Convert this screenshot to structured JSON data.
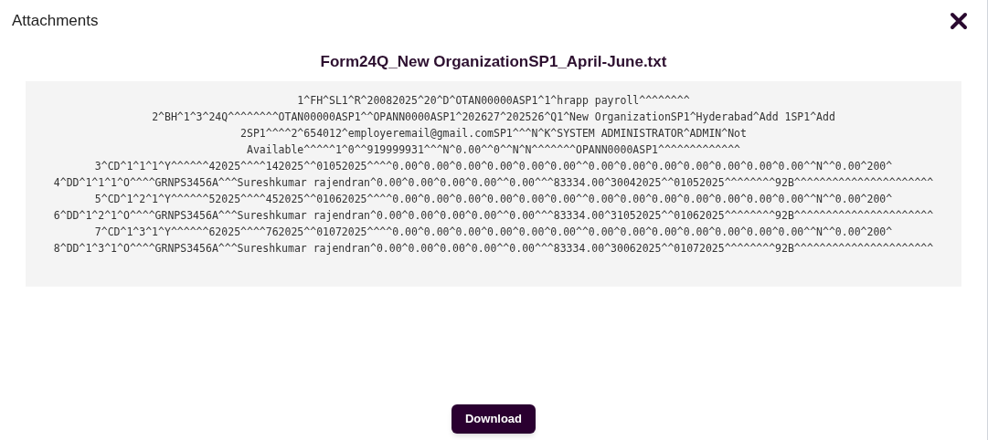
{
  "dialog": {
    "title": "Attachments"
  },
  "file": {
    "name": "Form24Q_New OrganizationSP1_April-June.txt",
    "lines": [
      "1^FH^SL1^R^20082025^20^D^OTAN00000ASP1^1^hrapp payroll^^^^^^^^",
      "2^BH^1^3^24Q^^^^^^^^OTAN00000ASP1^^OPANN0000ASP1^202627^202526^Q1^New OrganizationSP1^Hyderabad^Add 1SP1^Add",
      "2SP1^^^^2^654012^employeremail@gmail.comSP1^^^N^K^SYSTEM ADMINISTRATOR^ADMIN^Not",
      "Available^^^^^1^0^^919999931^^^N^0.00^^0^^N^N^^^^^^^OPANN0000ASP1^^^^^^^^^^^^^",
      "3^CD^1^1^1^Y^^^^^^42025^^^^142025^^01052025^^^^0.00^0.00^0.00^0.00^0.00^0.00^^0.00^0.00^0.00^0.00^0.00^0.00^0.00^^N^^0.00^200^",
      "4^DD^1^1^1^O^^^^GRNPS3456A^^^Sureshkumar rajendran^0.00^0.00^0.00^0.00^^0.00^^^83334.00^30042025^^01052025^^^^^^^^92B^^^^^^^^^^^^^^^^^^^^^^",
      "5^CD^1^2^1^Y^^^^^^52025^^^^452025^^01062025^^^^0.00^0.00^0.00^0.00^0.00^0.00^^0.00^0.00^0.00^0.00^0.00^0.00^0.00^^N^^0.00^200^",
      "6^DD^1^2^1^O^^^^GRNPS3456A^^^Sureshkumar rajendran^0.00^0.00^0.00^0.00^^0.00^^^83334.00^31052025^^01062025^^^^^^^^92B^^^^^^^^^^^^^^^^^^^^^^",
      "7^CD^1^3^1^Y^^^^^^62025^^^^762025^^01072025^^^^0.00^0.00^0.00^0.00^0.00^0.00^^0.00^0.00^0.00^0.00^0.00^0.00^0.00^^N^^0.00^200^",
      "8^DD^1^3^1^O^^^^GRNPS3456A^^^Sureshkumar rajendran^0.00^0.00^0.00^0.00^^0.00^^^83334.00^30062025^^01072025^^^^^^^^92B^^^^^^^^^^^^^^^^^^^^^^"
    ]
  },
  "buttons": [
    "Download"
  ]
}
